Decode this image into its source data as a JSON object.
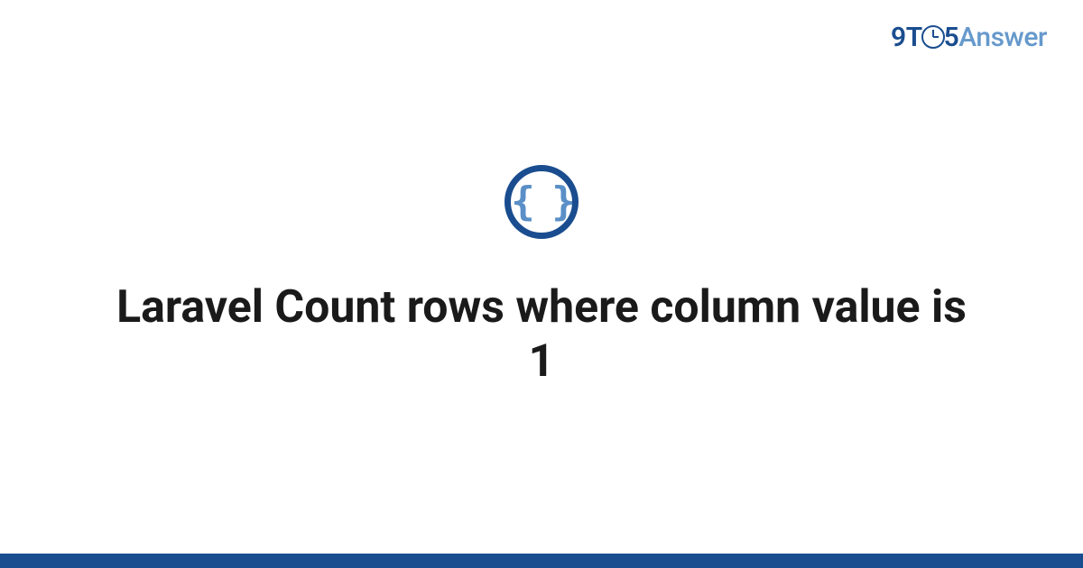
{
  "logo": {
    "nine": "9",
    "t": "T",
    "five": "5",
    "answer": "Answer"
  },
  "icon": {
    "braces": "{ }"
  },
  "title": "Laravel Count rows where column value is 1"
}
